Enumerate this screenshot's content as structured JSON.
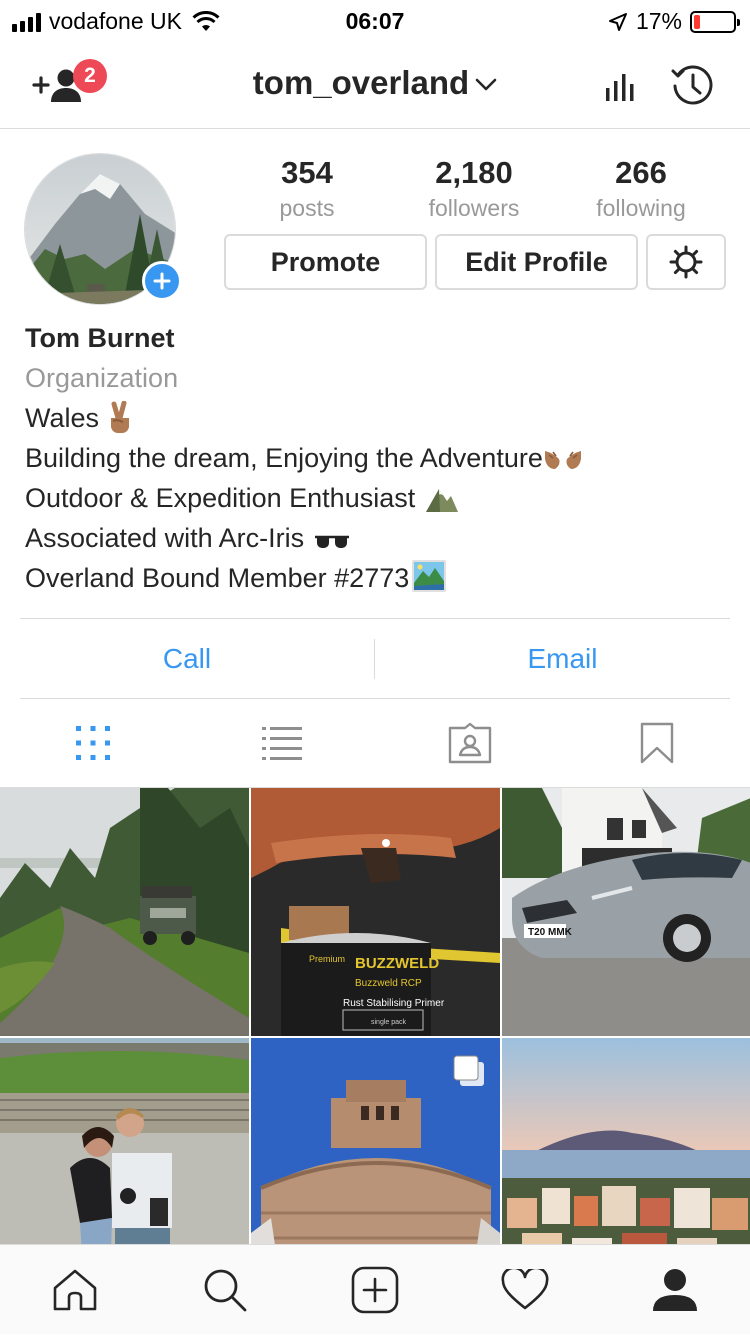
{
  "status_bar": {
    "carrier": "vodafone UK",
    "time": "06:07",
    "battery_percent": "17%",
    "battery_level": 0.17
  },
  "header": {
    "username": "tom_overland",
    "notification_count": "2"
  },
  "profile": {
    "stats": [
      {
        "value": "354",
        "label": "posts"
      },
      {
        "value": "2,180",
        "label": "followers"
      },
      {
        "value": "266",
        "label": "following"
      }
    ],
    "buttons": {
      "promote": "Promote",
      "edit_profile": "Edit Profile"
    },
    "name": "Tom Burnet",
    "category": "Organization",
    "bio_lines": [
      "Wales",
      "Building the dream, Enjoying the Adventure",
      "Outdoor & Expedition Enthusiast",
      "Associated with Arc-Iris",
      "Overland Bound Member #2773"
    ]
  },
  "contact": {
    "call": "Call",
    "email": "Email"
  },
  "posts": {
    "photo2_brand": "BUZZWELD",
    "photo2_product": "Buzzweld RCP",
    "photo2_desc": "Rust Stabilising Primer",
    "photo2_premium": "Premium",
    "photo2_pack": "single pack",
    "photo3_plate": "T20 MMK"
  },
  "colors": {
    "accent": "#3897f0",
    "badge": "#ed4956",
    "text": "#262626",
    "muted": "#999999",
    "border": "#dbdbdb"
  }
}
